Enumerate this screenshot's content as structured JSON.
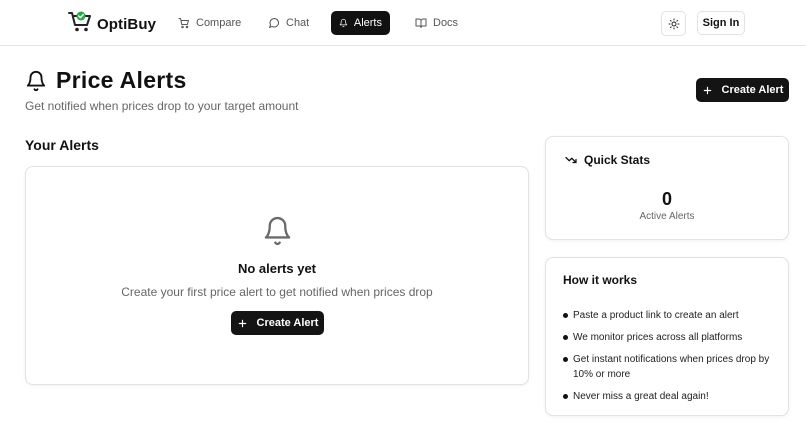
{
  "brand": {
    "name": "OptiBuy",
    "accent": "#2aa84a"
  },
  "nav": {
    "links": [
      {
        "label": "Compare",
        "icon": "cart-icon"
      },
      {
        "label": "Chat",
        "icon": "chat-bubble-icon"
      },
      {
        "label": "Alerts",
        "icon": "bell-icon",
        "active": true
      },
      {
        "label": "Docs",
        "icon": "book-icon"
      }
    ],
    "theme_icon": "sun-icon",
    "signin_label": "Sign In"
  },
  "header": {
    "title": "Price Alerts",
    "subtitle": "Get notified when prices drop to your target amount",
    "create_label": "Create Alert"
  },
  "alerts": {
    "section_title": "Your Alerts",
    "empty_title": "No alerts yet",
    "empty_desc": "Create your first price alert to get notified when prices drop",
    "create_label": "Create Alert"
  },
  "stats": {
    "title": "Quick Stats",
    "value": "0",
    "label": "Active Alerts"
  },
  "how": {
    "title": "How it works",
    "steps": [
      "Paste a product link to create an alert",
      "We monitor prices across all platforms",
      "Get instant notifications when prices drop by 10% or more",
      "Never miss a great deal again!"
    ]
  },
  "colors": {
    "primary": "#141414",
    "muted_text": "#666666",
    "border": "#e2e2e2"
  }
}
